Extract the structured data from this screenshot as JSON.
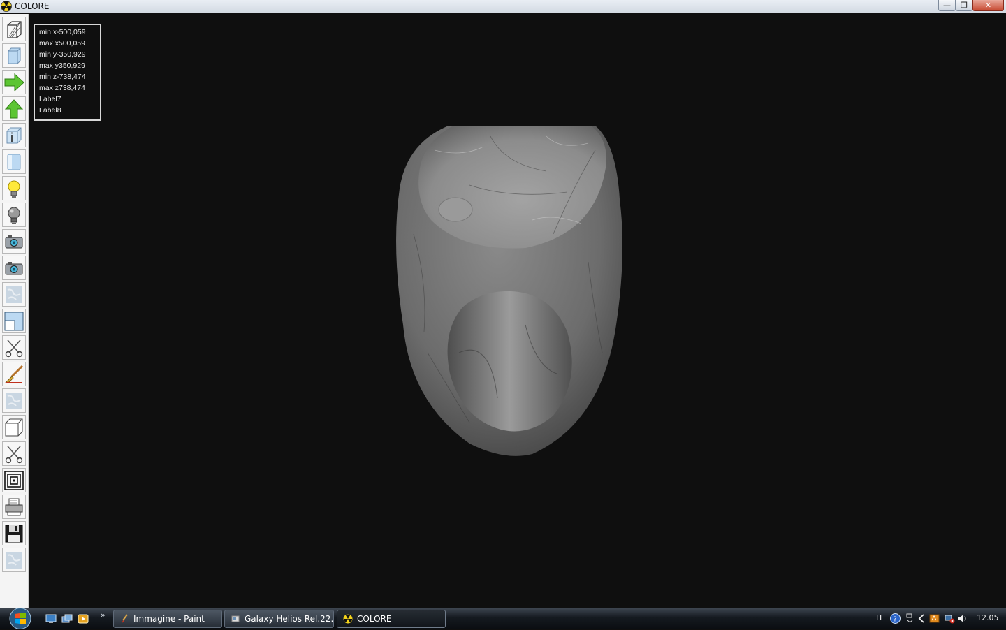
{
  "window": {
    "title": "COLORE",
    "minimize_glyph": "—",
    "maximize_glyph": "❐",
    "close_glyph": "✕"
  },
  "toolbar": {
    "tools": [
      {
        "name": "wireframe-cube-icon"
      },
      {
        "name": "solid-cube-icon"
      },
      {
        "name": "arrow-right-icon"
      },
      {
        "name": "arrow-up-icon"
      },
      {
        "name": "cube-info-icon"
      },
      {
        "name": "cylinder-icon"
      },
      {
        "name": "light-bulb-on-icon"
      },
      {
        "name": "light-bulb-off-icon"
      },
      {
        "name": "camera-icon"
      },
      {
        "name": "camera-alt-icon"
      },
      {
        "name": "marble-texture-icon"
      },
      {
        "name": "window-split-icon"
      },
      {
        "name": "scissors-icon"
      },
      {
        "name": "paintbrush-icon"
      },
      {
        "name": "marble-texture-2-icon"
      },
      {
        "name": "box-outline-icon"
      },
      {
        "name": "scissors-2-icon"
      },
      {
        "name": "concentric-squares-icon"
      },
      {
        "name": "printer-icon"
      },
      {
        "name": "floppy-disk-icon"
      },
      {
        "name": "marble-texture-3-icon"
      }
    ]
  },
  "info": {
    "min_x": "min x-500,059",
    "max_x": "max x500,059",
    "min_y": "min y-350,929",
    "max_y": "max y350,929",
    "min_z": "min z-738,474",
    "max_z": "max z738,474",
    "label7": "Label7",
    "label8": "Label8"
  },
  "taskbar": {
    "more_glyph": "»",
    "tasks": [
      {
        "label": "Immagine - Paint"
      },
      {
        "label": "Galaxy Helios  Rel.22..."
      },
      {
        "label": "COLORE"
      }
    ],
    "tray": {
      "language": "IT",
      "time": "12.05"
    }
  },
  "colors": {
    "viewport_bg": "#0f0f0f",
    "marble": "#7a7a7a",
    "taskbar": "#151a20"
  }
}
